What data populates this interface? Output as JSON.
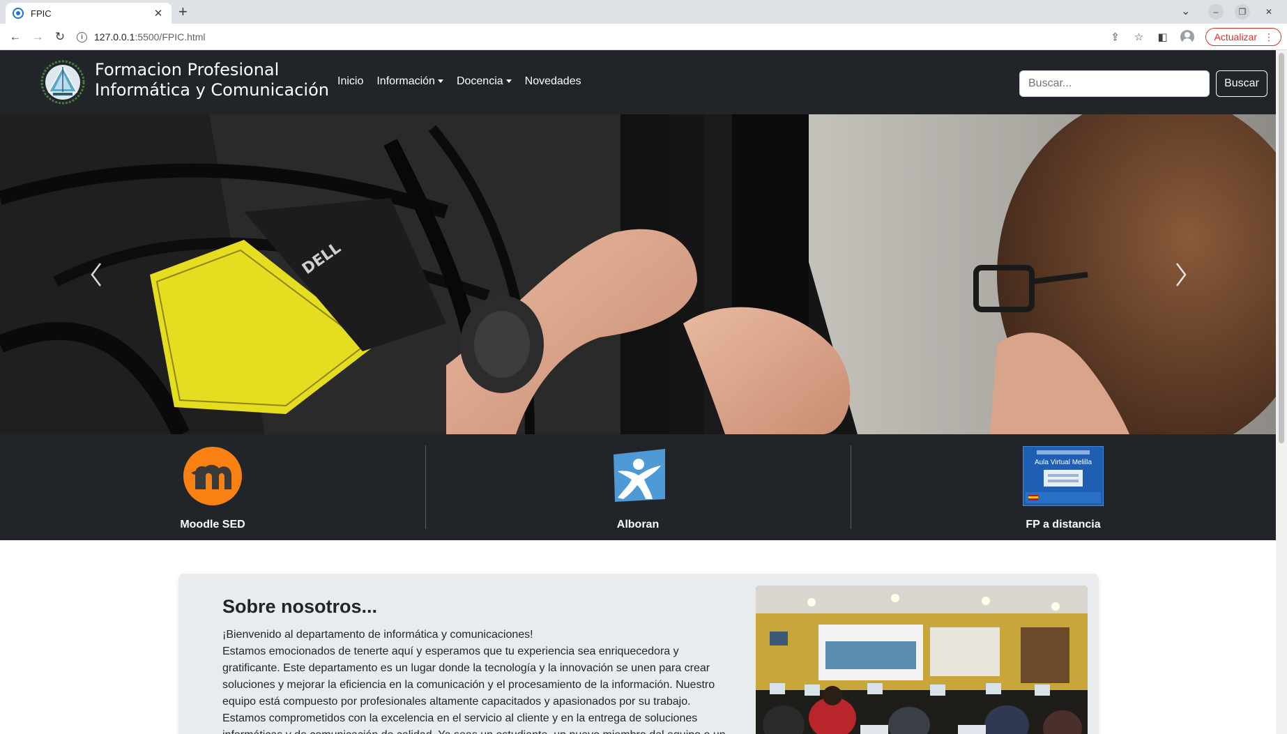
{
  "browser": {
    "tab_title": "FPIC",
    "close_glyph": "✕",
    "new_tab_glyph": "+",
    "url_host": "127.0.0.1",
    "url_rest": ":5500/FPIC.html",
    "update_label": "Actualizar",
    "menu_glyph": "⋮",
    "back_glyph": "←",
    "forward_glyph": "→",
    "reload_glyph": "↻",
    "minimize_glyph": "–",
    "restore_glyph": "❐",
    "win_close_glyph": "✕",
    "tabs_chevron_glyph": "⌄",
    "share_glyph": "⇪",
    "star_glyph": "☆",
    "sidepanel_glyph": "◧"
  },
  "site": {
    "brand_line1": "Formacion Profesional",
    "brand_line2": "Informática y Comunicación",
    "nav": [
      {
        "label": "Inicio"
      },
      {
        "label": "Información",
        "dropdown": true
      },
      {
        "label": "Docencia",
        "dropdown": true
      },
      {
        "label": "Novedades"
      }
    ],
    "search_placeholder": "Buscar...",
    "search_button": "Buscar"
  },
  "quick_links": [
    {
      "label": "Moodle SED",
      "icon": "moodle-icon",
      "color": "#f98012"
    },
    {
      "label": "Alboran",
      "icon": "alboran-icon",
      "color": "#4e9ad6"
    },
    {
      "label": "FP a distancia",
      "icon": "aula-virtual-icon",
      "color": "#1e5fb4"
    }
  ],
  "about": {
    "title": "Sobre nosotros...",
    "paragraph_line1": "¡Bienvenido al departamento de informática y comunicaciones!",
    "paragraph_rest": "Estamos emocionados de tenerte aquí y esperamos que tu experiencia sea enriquecedora y gratificante. Este departamento es un lugar donde la tecnología y la innovación se unen para crear soluciones y mejorar la eficiencia en la comunicación y el procesamiento de la información. Nuestro equipo está compuesto por profesionales altamente capacitados y apasionados por su trabajo. Estamos comprometidos con la excelencia en el servicio al cliente y en la entrega de soluciones informáticas y de comunicación de calidad. Ya seas un estudiante, un nuevo miembro del equipo o un"
  },
  "aula_virtual_banner_text": "Aula Virtual Melilla",
  "colors": {
    "navbar_bg": "#212529",
    "about_bg": "#e9ecef",
    "update_red": "#d93025"
  }
}
